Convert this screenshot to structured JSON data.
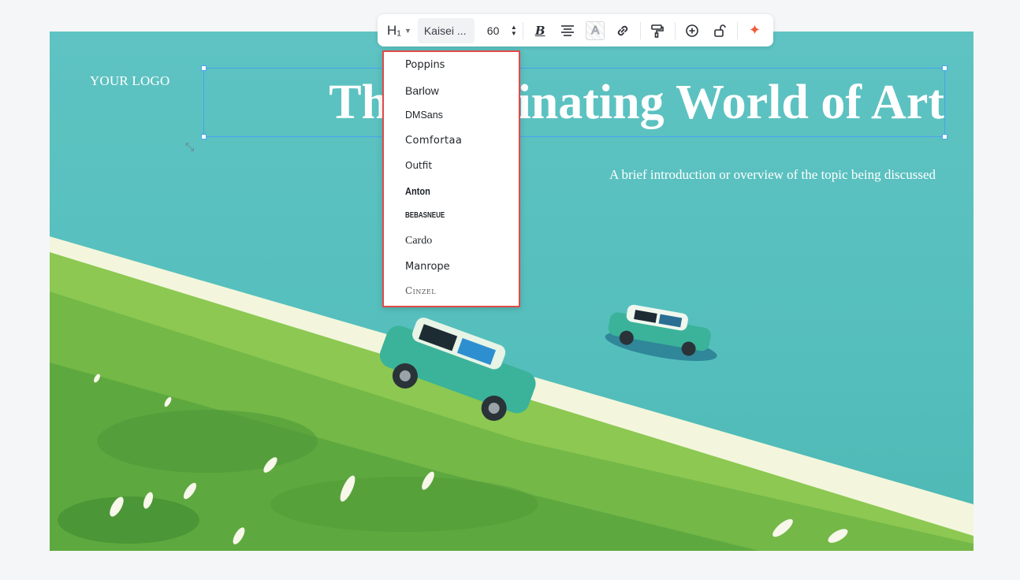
{
  "canvas": {
    "logo_text": "YOUR LOGO",
    "title": "The Fascinating World of Art",
    "subtitle": "A brief introduction or overview of the topic being discussed"
  },
  "toolbar": {
    "heading_label": "H₁",
    "font_value": "Kaisei ...",
    "font_size": "60",
    "icons": [
      "heading-icon",
      "chevron-down-icon",
      "stepper-icon",
      "bold-icon",
      "align-center-icon",
      "text-color-icon",
      "link-icon",
      "format-painter-icon",
      "add-comment-icon",
      "unlock-icon",
      "ai-sparkle-icon"
    ]
  },
  "font_dropdown": {
    "items": [
      "Poppins",
      "Barlow",
      "DMSans",
      "Comfortaa",
      "Outfit",
      "Anton",
      "BEBASNEUE",
      "Cardo",
      "Manrope",
      "Cinzel"
    ]
  },
  "colors": {
    "selection_border": "#4aa3f0",
    "dropdown_highlight": "#e04a4a",
    "sparkle": "#f25c3b",
    "sky": "#5ec3c2"
  }
}
